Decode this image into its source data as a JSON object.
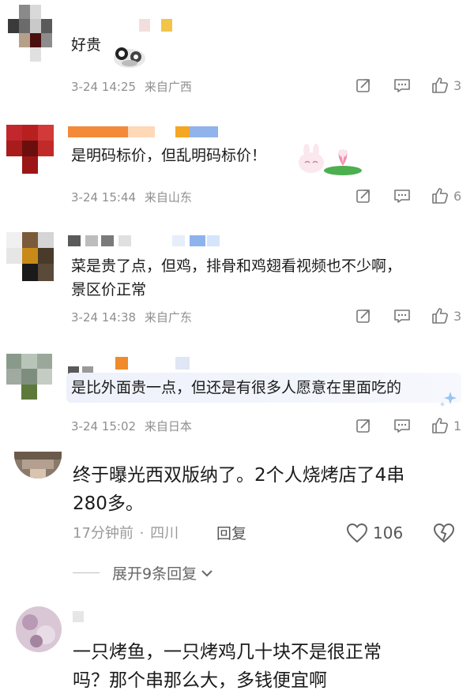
{
  "comments": [
    {
      "id": "c1",
      "text": "好贵",
      "date": "3-24 14:25",
      "location": "来自广西",
      "likes": "3"
    },
    {
      "id": "c2",
      "text": "是明码标价，但乱明码标价！",
      "date": "3-24 15:44",
      "location": "来自山东",
      "likes": "6"
    },
    {
      "id": "c3",
      "text_line1": "菜是贵了点，但鸡，排骨和鸡翅看视频也不少啊，",
      "text_line2": "景区价正常",
      "date": "3-24 14:38",
      "location": "来自广东",
      "likes": "3"
    },
    {
      "id": "c4",
      "text": "是比外面贵一点，但还是有很多人愿意在里面吃的",
      "date": "3-24 15:02",
      "location": "来自日本",
      "likes": "1"
    }
  ],
  "app2": {
    "comment1": {
      "text_line1": "终于曝光西双版纳了。2个人烧烤店了4串",
      "text_line2": "280多。",
      "time": "17分钟前",
      "separator": "·",
      "location": "四川",
      "reply_label": "回复",
      "likes": "106",
      "expand_label": "展开9条回复"
    },
    "comment2": {
      "text_line1": "一只烤鱼，一只烤鸡几十块不是很正常",
      "text_line2": "吗？那个串那么大，多钱便宜啊"
    }
  },
  "colors": {
    "meta": "#8f8f8f",
    "divider": "#e6e6e6"
  }
}
